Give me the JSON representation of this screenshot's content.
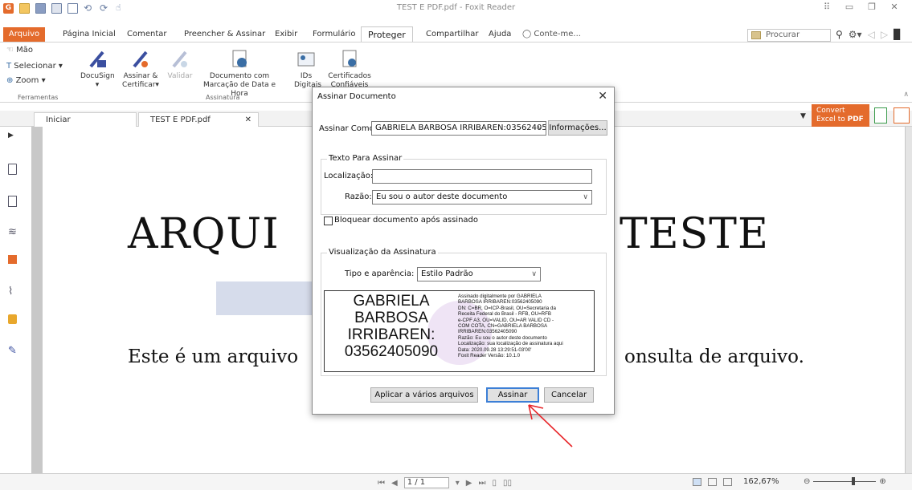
{
  "window": {
    "title": "TEST E PDF.pdf - Foxit Reader"
  },
  "ribbon_tabs": [
    "Arquivo",
    "Página Inicial",
    "Comentar",
    "Preencher & Assinar",
    "Exibir",
    "Formulário",
    "Proteger",
    "Compartilhar",
    "Ajuda",
    "Conte-me..."
  ],
  "search": {
    "placeholder": "Procurar"
  },
  "ribbon": {
    "tools": {
      "hand": "Mão",
      "select": "Selecionar",
      "zoom": "Zoom",
      "group": "Ferramentas"
    },
    "docusign": "DocuSign",
    "sign_certify_1": "Assinar &",
    "sign_certify_2": "Certificar",
    "validate": "Validar",
    "timestamp_1": "Documento com",
    "timestamp_2": "Marcação de Data e Hora",
    "ids_1": "IDs",
    "ids_2": "Digitais",
    "certs_1": "Certificados",
    "certs_2": "Confiáveis",
    "sign_group": "Assinatura"
  },
  "doc_tabs": {
    "start": "Iniciar",
    "file": "TEST E PDF.pdf"
  },
  "convert_ad": {
    "line1": "Convert",
    "line2a": "Excel to ",
    "line2b": "PDF"
  },
  "document": {
    "title_left": "ARQUI",
    "title_right": "TESTE",
    "body_left": "Este é um arquivo",
    "body_right": "onsulta de arquivo."
  },
  "dialog": {
    "title": "Assinar Documento",
    "sign_as_label": "Assinar Como:",
    "sign_as_value": "GABRIELA BARBOSA IRRIBAREN:03562405",
    "info_button": "Informações...",
    "text_group": "Texto Para Assinar",
    "location_label": "Localização:",
    "location_value": "",
    "reason_label": "Razão:",
    "reason_value": "Eu sou o autor deste documento",
    "lock_label": "Bloquear documento após assinado",
    "lock_checked": false,
    "preview_group": "Visualização da Assinatura",
    "appearance_label": "Tipo e aparência:",
    "appearance_value": "Estilo Padrão",
    "signature": {
      "name_lines": [
        "GABRIELA",
        "BARBOSA",
        "IRRIBAREN:",
        "03562405090"
      ],
      "detail_lines": [
        "Assinado digitalmente por GABRIELA",
        "BARBOSA IRRIBAREN:03562405090",
        "DN: C=BR, O=ICP-Brasil, OU=Secretaria da",
        "Receita Federal do Brasil - RFB, OU=RFB",
        "e-CPF A3, OU=VALID, OU=AR VALID CD -",
        "COM COTA, CN=GABRIELA BARBOSA",
        "IRRIBAREN:03562405090",
        "Razão: Eu sou o autor deste documento",
        "Localização: sua localização de assinatura aqui",
        "Data: 2020.09.28 13:29:51-03'00'",
        "Foxit Reader Versão: 10.1.0"
      ]
    },
    "apply_button": "Aplicar a vários arquivos",
    "sign_button": "Assinar",
    "cancel_button": "Cancelar"
  },
  "status": {
    "page": "1 / 1",
    "zoom": "162,67%"
  },
  "colors": {
    "brand": "#e46b2c",
    "accent_blue": "#3c7fd6",
    "annotation_arrow": "#e8262a"
  }
}
